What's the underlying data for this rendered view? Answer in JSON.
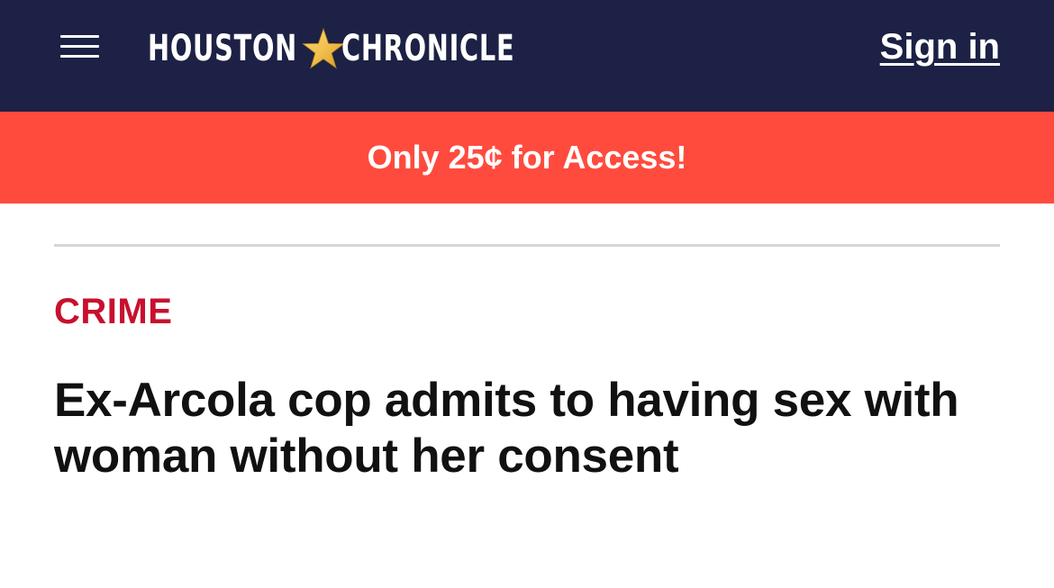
{
  "header": {
    "menu_icon": "hamburger-menu-icon",
    "logo": {
      "word_left": "HOUSTON",
      "word_right": "CHRONICLE",
      "star_icon": "star-icon",
      "star_color": "#f2c14e"
    },
    "sign_in_label": "Sign in",
    "background_color": "#1c2145"
  },
  "promo": {
    "text": "Only 25¢ for Access!",
    "background_color": "#ff4b3e"
  },
  "article": {
    "section": "CRIME",
    "section_color": "#c8102e",
    "headline": "Ex-Arcola cop admits to having sex with woman without her consent"
  }
}
